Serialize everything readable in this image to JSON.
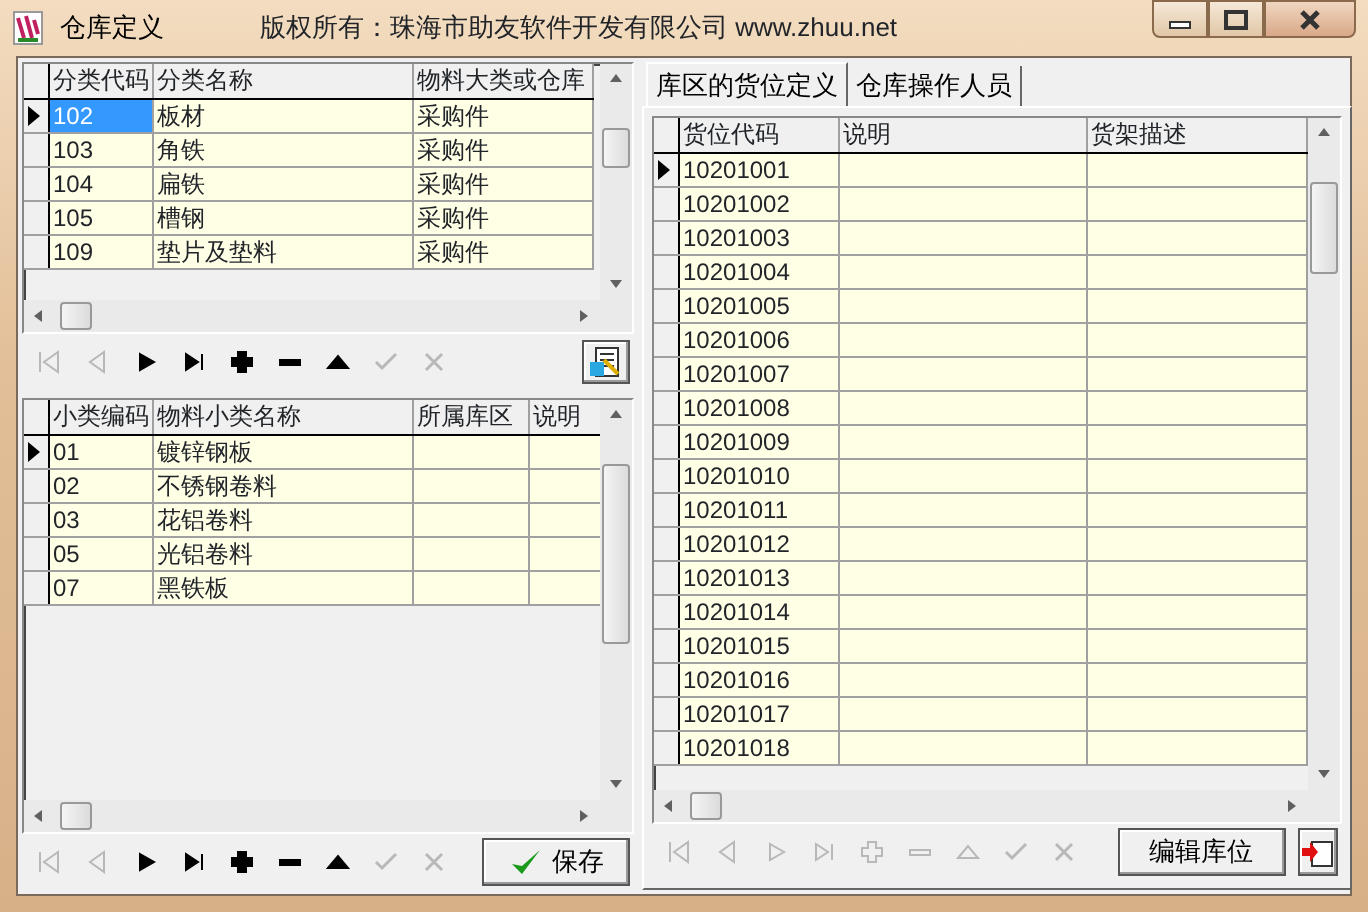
{
  "window": {
    "title": "仓库定义",
    "caption": "版权所有：珠海市助友软件开发有限公司 www.zhuu.net"
  },
  "left": {
    "top_grid": {
      "focused": true,
      "columns": [
        "分类代码",
        "分类名称",
        "物料大类或仓库"
      ],
      "rows": [
        {
          "cells": [
            "102",
            "板材",
            "采购件"
          ],
          "selected": true
        },
        {
          "cells": [
            "103",
            "角铁",
            "采购件"
          ],
          "selected": false
        },
        {
          "cells": [
            "104",
            "扁铁",
            "采购件"
          ],
          "selected": false
        },
        {
          "cells": [
            "105",
            "槽钢",
            "采购件"
          ],
          "selected": false
        },
        {
          "cells": [
            "109",
            "垫片及垫料",
            "采购件"
          ],
          "selected": false
        }
      ]
    },
    "top_navigator": [
      {
        "kind": "first",
        "disabled": true
      },
      {
        "kind": "prior",
        "disabled": true
      },
      {
        "kind": "next",
        "disabled": false
      },
      {
        "kind": "last",
        "disabled": false
      },
      {
        "kind": "insert",
        "disabled": false
      },
      {
        "kind": "delete",
        "disabled": false
      },
      {
        "kind": "edit",
        "disabled": false
      },
      {
        "kind": "post",
        "disabled": true
      },
      {
        "kind": "cancel",
        "disabled": true
      }
    ],
    "bottom_grid": {
      "focused": false,
      "columns": [
        "小类编码",
        "物料小类名称",
        "所属库区",
        "说明"
      ],
      "rows": [
        {
          "cells": [
            "01",
            "镀锌钢板"
          ],
          "selected": true
        },
        {
          "cells": [
            "02",
            "不锈钢卷料"
          ],
          "selected": false
        },
        {
          "cells": [
            "03",
            "花铝卷料"
          ],
          "selected": false
        },
        {
          "cells": [
            "05",
            "光铝卷料"
          ],
          "selected": false
        },
        {
          "cells": [
            "07",
            "黑铁板"
          ],
          "selected": false
        }
      ]
    },
    "bottom_navigator": [
      {
        "kind": "first",
        "disabled": true
      },
      {
        "kind": "prior",
        "disabled": true
      },
      {
        "kind": "next",
        "disabled": false
      },
      {
        "kind": "last",
        "disabled": false
      },
      {
        "kind": "insert",
        "disabled": false
      },
      {
        "kind": "delete",
        "disabled": false
      },
      {
        "kind": "edit",
        "disabled": false
      },
      {
        "kind": "post",
        "disabled": true
      },
      {
        "kind": "cancel",
        "disabled": true
      }
    ],
    "save_button": "保存"
  },
  "right": {
    "tabs": [
      {
        "label": "库区的货位定义",
        "selected": true
      },
      {
        "label": "仓库操作人员",
        "selected": false
      }
    ],
    "grid": {
      "focused": false,
      "columns": [
        "货位代码",
        "说明",
        "货架描述"
      ],
      "rows": [
        {
          "cells": [
            "10201001"
          ],
          "selected": true
        },
        {
          "cells": [
            "10201002"
          ],
          "selected": false
        },
        {
          "cells": [
            "10201003"
          ],
          "selected": false
        },
        {
          "cells": [
            "10201004"
          ],
          "selected": false
        },
        {
          "cells": [
            "10201005"
          ],
          "selected": false
        },
        {
          "cells": [
            "10201006"
          ],
          "selected": false
        },
        {
          "cells": [
            "10201007"
          ],
          "selected": false
        },
        {
          "cells": [
            "10201008"
          ],
          "selected": false
        },
        {
          "cells": [
            "10201009"
          ],
          "selected": false
        },
        {
          "cells": [
            "10201010"
          ],
          "selected": false
        },
        {
          "cells": [
            "10201011"
          ],
          "selected": false
        },
        {
          "cells": [
            "10201012"
          ],
          "selected": false
        },
        {
          "cells": [
            "10201013"
          ],
          "selected": false
        },
        {
          "cells": [
            "10201014"
          ],
          "selected": false
        },
        {
          "cells": [
            "10201015"
          ],
          "selected": false
        },
        {
          "cells": [
            "10201016"
          ],
          "selected": false
        },
        {
          "cells": [
            "10201017"
          ],
          "selected": false
        },
        {
          "cells": [
            "10201018"
          ],
          "selected": false
        }
      ]
    },
    "navigator": [
      {
        "kind": "first",
        "disabled": true
      },
      {
        "kind": "prior",
        "disabled": true
      },
      {
        "kind": "next",
        "disabled": true
      },
      {
        "kind": "last",
        "disabled": true
      },
      {
        "kind": "insert",
        "disabled": true
      },
      {
        "kind": "delete",
        "disabled": true
      },
      {
        "kind": "edit",
        "disabled": true
      },
      {
        "kind": "post",
        "disabled": true
      },
      {
        "kind": "cancel",
        "disabled": true
      }
    ],
    "edit_button": "编辑库位"
  }
}
